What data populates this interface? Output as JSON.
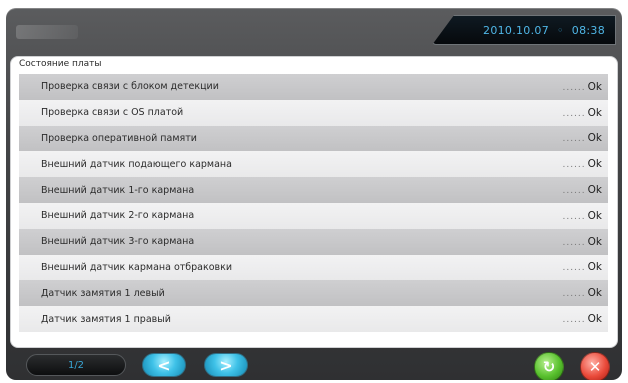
{
  "header": {
    "date": "2010.10.07",
    "time": "08:38"
  },
  "panel": {
    "title": "Состояние платы",
    "rows": [
      {
        "label": "Проверка связи с блоком детекции",
        "dots": "......",
        "status": "Ok"
      },
      {
        "label": "Проверка связи с OS платой",
        "dots": "......",
        "status": "Ok"
      },
      {
        "label": "Проверка оперативной памяти",
        "dots": "......",
        "status": "Ok"
      },
      {
        "label": "Внешний датчик подающего кармана",
        "dots": "......",
        "status": "Ok"
      },
      {
        "label": "Внешний датчик 1-го кармана",
        "dots": "......",
        "status": "Ok"
      },
      {
        "label": "Внешний датчик 2-го кармана",
        "dots": "......",
        "status": "Ok"
      },
      {
        "label": "Внешний датчик 3-го кармана",
        "dots": "......",
        "status": "Ok"
      },
      {
        "label": "Внешний датчик кармана отбраковки",
        "dots": "......",
        "status": "Ok"
      },
      {
        "label": "Датчик замятия 1 левый",
        "dots": "......",
        "status": "Ok"
      },
      {
        "label": "Датчик замятия 1 правый",
        "dots": "......",
        "status": "Ok"
      }
    ]
  },
  "footer": {
    "page": "1/2",
    "prev_icon": "chevron-left-icon",
    "next_icon": "chevron-right-icon",
    "refresh_icon": "refresh-icon",
    "close_icon": "close-icon"
  },
  "colors": {
    "accent": "#3fc2e8",
    "ok_green": "#58c02d",
    "close_red": "#ea4a3a",
    "row_dark": "#c8c8ca",
    "row_light": "#efeff0"
  }
}
